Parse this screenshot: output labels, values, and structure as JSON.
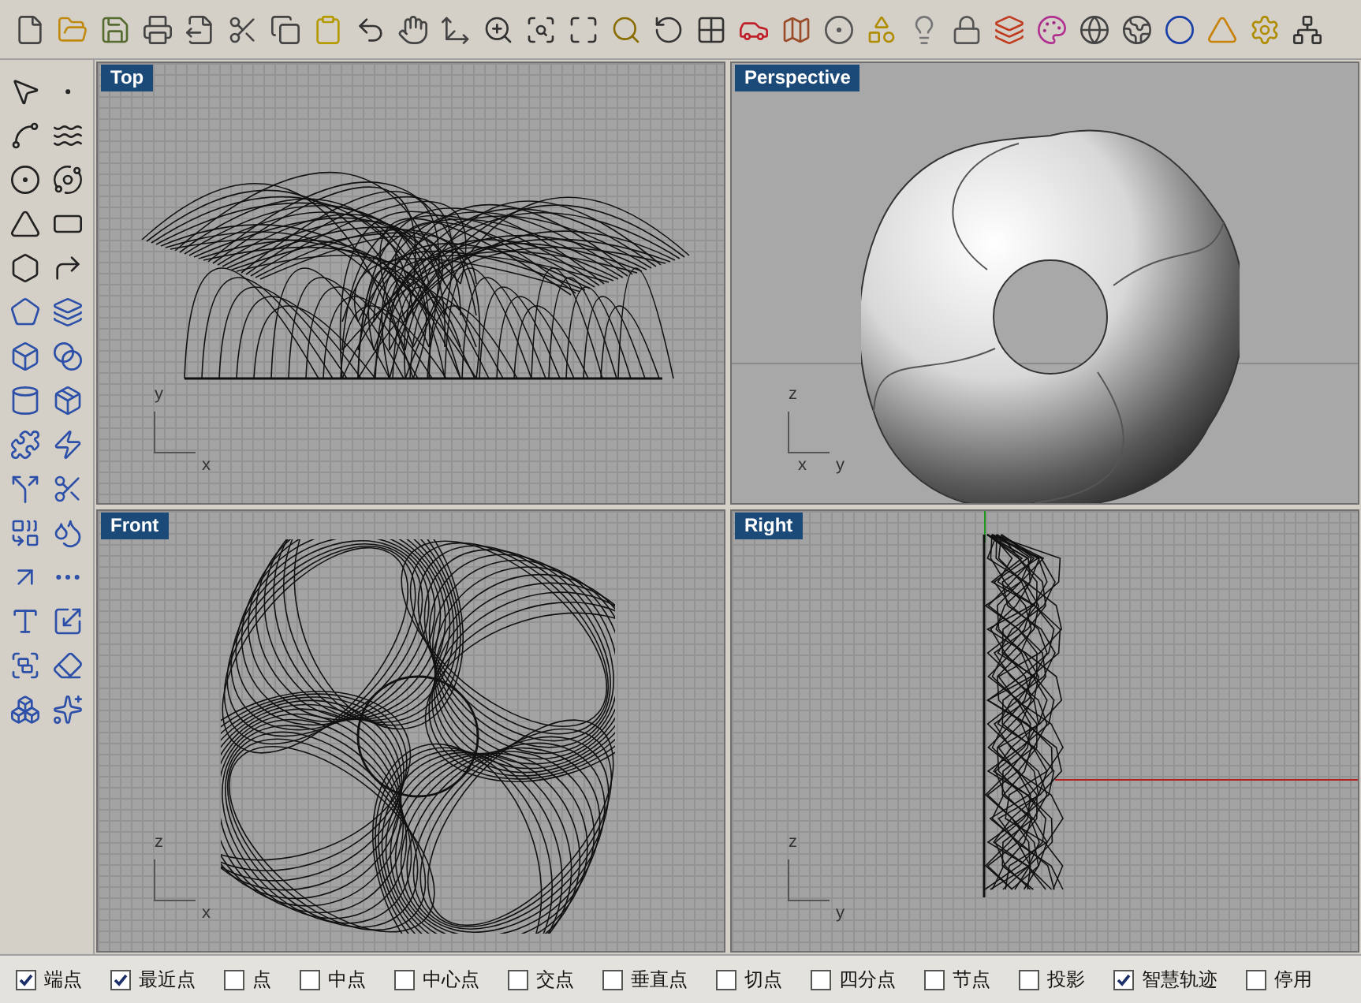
{
  "viewports": [
    {
      "title": "Top",
      "kind": "top",
      "axes": [
        "y",
        "x"
      ]
    },
    {
      "title": "Perspective",
      "kind": "perspective",
      "axes": [
        "z",
        "x",
        "y"
      ]
    },
    {
      "title": "Front",
      "kind": "front",
      "axes": [
        "z",
        "x"
      ]
    },
    {
      "title": "Right",
      "kind": "right",
      "axes": [
        "z",
        "y"
      ]
    }
  ],
  "status_bar": [
    {
      "label": "端点",
      "checked": true
    },
    {
      "label": "最近点",
      "checked": true
    },
    {
      "label": "点",
      "checked": false
    },
    {
      "label": "中点",
      "checked": false
    },
    {
      "label": "中心点",
      "checked": false
    },
    {
      "label": "交点",
      "checked": false
    },
    {
      "label": "垂直点",
      "checked": false
    },
    {
      "label": "切点",
      "checked": false
    },
    {
      "label": "四分点",
      "checked": false
    },
    {
      "label": "节点",
      "checked": false
    },
    {
      "label": "投影",
      "checked": false
    },
    {
      "label": "智慧轨迹",
      "checked": true
    },
    {
      "label": "停用",
      "checked": false
    }
  ]
}
